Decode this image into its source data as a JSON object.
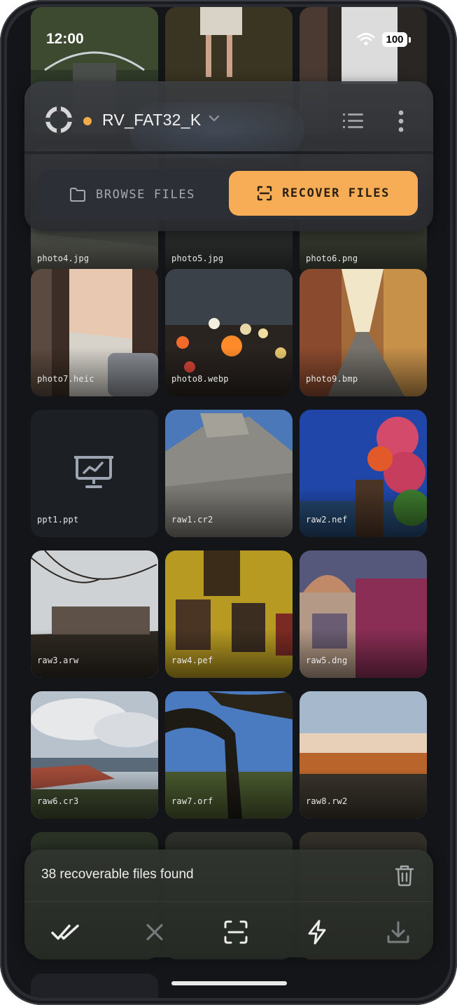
{
  "status": {
    "time": "12:00",
    "battery": "100"
  },
  "header": {
    "drive_name": "RV_FAT32_K",
    "drive_status_color": "#f1a94c",
    "tabs": [
      {
        "label": "BROWSE FILES",
        "icon": "folder-icon",
        "active": false
      },
      {
        "label": "RECOVER FILES",
        "icon": "scan-icon",
        "active": true
      }
    ],
    "accent": "#f6ad55"
  },
  "files": [
    {
      "name": "photo4.jpg"
    },
    {
      "name": "photo5.jpg"
    },
    {
      "name": "photo6.png"
    },
    {
      "name": "photo7.heic"
    },
    {
      "name": "photo8.webp"
    },
    {
      "name": "photo9.bmp"
    },
    {
      "name": "ppt1.ppt",
      "icon": "presentation-icon"
    },
    {
      "name": "raw1.cr2"
    },
    {
      "name": "raw2.nef"
    },
    {
      "name": "raw3.arw"
    },
    {
      "name": "raw4.pef"
    },
    {
      "name": "raw5.dng"
    },
    {
      "name": "raw6.cr3"
    },
    {
      "name": "raw7.orf"
    },
    {
      "name": "raw8.rw2"
    }
  ],
  "action_bar": {
    "summary": "38 recoverable files found",
    "actions": [
      "select-all-icon",
      "close-icon",
      "scan-icon",
      "bolt-icon",
      "download-icon"
    ]
  }
}
